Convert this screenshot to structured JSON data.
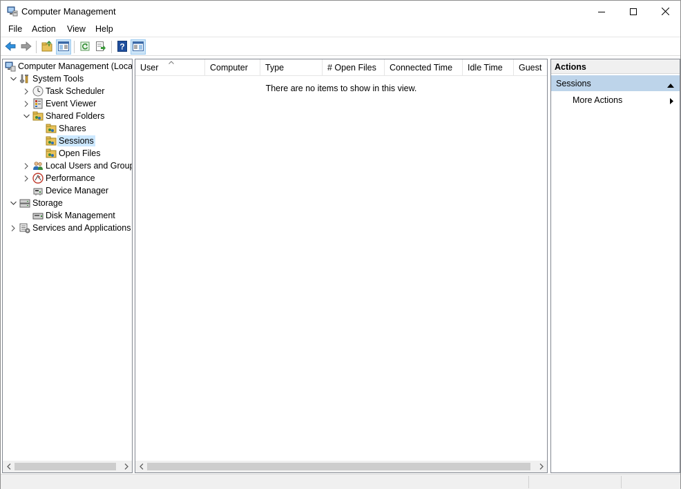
{
  "window": {
    "title": "Computer Management"
  },
  "menu": [
    "File",
    "Action",
    "View",
    "Help"
  ],
  "tree": [
    {
      "label": "Computer Management (Local",
      "icon": "computer-management-icon",
      "expander": ""
    },
    {
      "label": "System Tools",
      "icon": "system-tools-icon",
      "expander": "expanded"
    },
    {
      "label": "Task Scheduler",
      "icon": "clock-icon",
      "expander": "collapsed"
    },
    {
      "label": "Event Viewer",
      "icon": "event-viewer-icon",
      "expander": "collapsed"
    },
    {
      "label": "Shared Folders",
      "icon": "shared-folders-icon",
      "expander": "expanded"
    },
    {
      "label": "Shares",
      "icon": "shared-folder-icon",
      "expander": ""
    },
    {
      "label": "Sessions",
      "icon": "shared-folder-icon",
      "expander": ""
    },
    {
      "label": "Open Files",
      "icon": "shared-folder-icon",
      "expander": ""
    },
    {
      "label": "Local Users and Groups",
      "icon": "users-icon",
      "expander": "collapsed"
    },
    {
      "label": "Performance",
      "icon": "performance-icon",
      "expander": "collapsed"
    },
    {
      "label": "Device Manager",
      "icon": "device-manager-icon",
      "expander": ""
    },
    {
      "label": "Storage",
      "icon": "storage-icon",
      "expander": "expanded"
    },
    {
      "label": "Disk Management",
      "icon": "disk-icon",
      "expander": ""
    },
    {
      "label": "Services and Applications",
      "icon": "services-icon",
      "expander": "collapsed"
    }
  ],
  "list": {
    "columns": [
      "User",
      "Computer",
      "Type",
      "# Open Files",
      "Connected Time",
      "Idle Time",
      "Guest"
    ],
    "empty_message": "There are no items to show in this view."
  },
  "actions": {
    "title": "Actions",
    "section": "Sessions",
    "items": [
      "More Actions"
    ]
  },
  "colors": {
    "selection": "#cce8ff",
    "actions_section_bg": "#bdd4ea",
    "toolbar_pressed": "#cce4f7"
  }
}
